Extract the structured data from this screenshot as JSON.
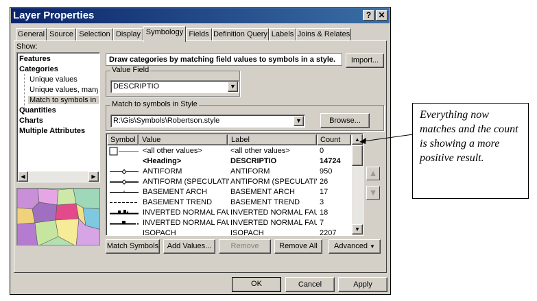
{
  "window": {
    "title": "Layer Properties",
    "help_label": "?",
    "close_label": "✕"
  },
  "tabs": [
    {
      "label": "General"
    },
    {
      "label": "Source"
    },
    {
      "label": "Selection"
    },
    {
      "label": "Display"
    },
    {
      "label": "Symbology"
    },
    {
      "label": "Fields"
    },
    {
      "label": "Definition Query"
    },
    {
      "label": "Labels"
    },
    {
      "label": "Joins & Relates"
    }
  ],
  "show": {
    "label": "Show:",
    "items": [
      {
        "label": "Features"
      },
      {
        "label": "Categories"
      },
      {
        "label": "Unique values"
      },
      {
        "label": "Unique values, many f"
      },
      {
        "label": "Match to symbols in a"
      },
      {
        "label": "Quantities"
      },
      {
        "label": "Charts"
      },
      {
        "label": "Multiple Attributes"
      }
    ]
  },
  "description": "Draw categories by matching field values to symbols in a style.",
  "import_label": "Import...",
  "value_field": {
    "legend": "Value Field",
    "value": "DESCRIPTIO"
  },
  "style": {
    "legend": "Match to symbols in Style",
    "value": "R:\\Gis\\Symbols\\Robertson.style",
    "browse_label": "Browse..."
  },
  "grid": {
    "headers": {
      "symbol": "Symbol",
      "value": "Value",
      "label": "Label",
      "count": "Count"
    },
    "rows": [
      {
        "value": "<all other values>",
        "label": "<all other values>",
        "count": "0"
      },
      {
        "value": "<Heading>",
        "label": "DESCRIPTIO",
        "count": "14724"
      },
      {
        "value": "ANTIFORM",
        "label": "ANTIFORM",
        "count": "950"
      },
      {
        "value": "ANTIFORM (SPECULATIVE",
        "label": "ANTIFORM (SPECULATIVE",
        "count": "26"
      },
      {
        "value": "BASEMENT ARCH",
        "label": "BASEMENT ARCH",
        "count": "17"
      },
      {
        "value": "BASEMENT TREND",
        "label": "BASEMENT TREND",
        "count": "3"
      },
      {
        "value": "INVERTED NORMAL FAUL",
        "label": "INVERTED NORMAL FAUL",
        "count": "18"
      },
      {
        "value": "INVERTED NORMAL FAUL",
        "label": "INVERTED NORMAL FAUL",
        "count": "7"
      },
      {
        "value": "ISOPACH",
        "label": "ISOPACH",
        "count": "2207"
      }
    ]
  },
  "buttons": {
    "match_symbols": "Match Symbols",
    "add_values": "Add Values...",
    "remove": "Remove",
    "remove_all": "Remove All",
    "advanced": "Advanced",
    "ok": "OK",
    "cancel": "Cancel",
    "apply": "Apply"
  },
  "callout": "Everything now matches and the count is showing a more positive result.",
  "colors": {
    "title_start": "#0a246a",
    "title_end": "#3a6ea5",
    "face": "#d4d0c8",
    "selection": "#d4d0c8"
  }
}
